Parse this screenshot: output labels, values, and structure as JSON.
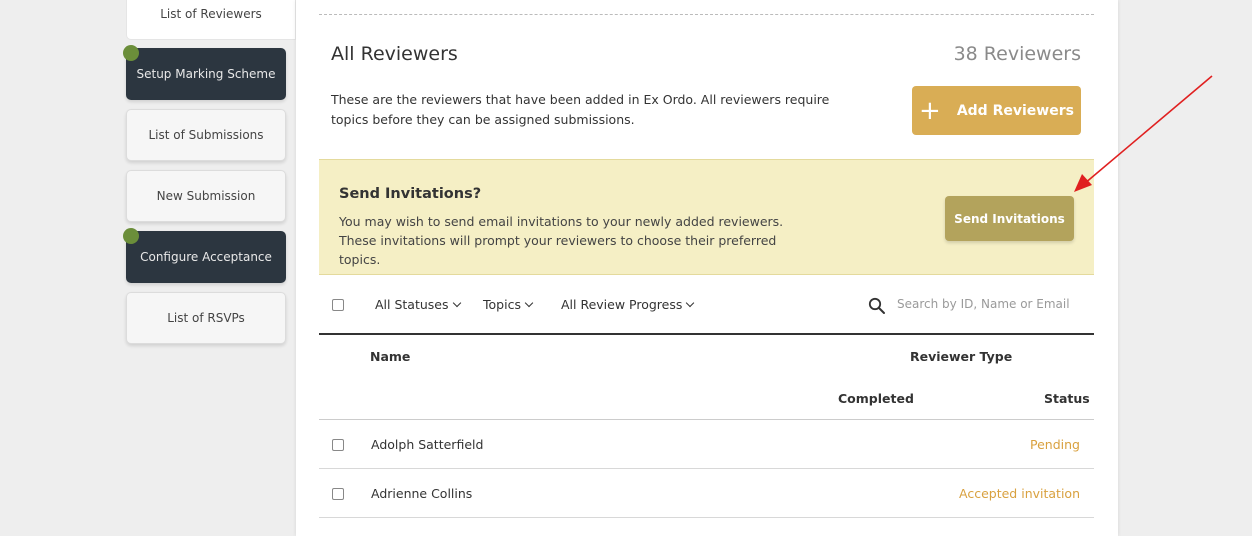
{
  "sidebar": {
    "items": [
      {
        "label": "List of Reviewers",
        "state": "active"
      },
      {
        "label": "Setup Marking Scheme",
        "state": "dark",
        "dot": true
      },
      {
        "label": "List of Submissions",
        "state": "normal"
      },
      {
        "label": "New Submission",
        "state": "normal"
      },
      {
        "label": "Configure Acceptance",
        "state": "dark",
        "dot": true
      },
      {
        "label": "List of RSVPs",
        "state": "normal"
      }
    ]
  },
  "main": {
    "title": "All Reviewers",
    "count": "38 Reviewers",
    "description": "These are the reviewers that have been added in Ex Ordo. All reviewers require topics before they can be assigned submissions.",
    "add_button": "Add Reviewers"
  },
  "invite": {
    "title": "Send Invitations?",
    "text": "You may wish to send email invitations to your newly added reviewers. These invitations will prompt your reviewers to choose their preferred topics.",
    "button": "Send Invitations"
  },
  "filters": {
    "statuses": "All Statuses",
    "topics": "Topics",
    "progress": "All Review Progress",
    "search_placeholder": "Search by ID, Name or Email"
  },
  "table": {
    "headers": {
      "name": "Name",
      "reviewer_type": "Reviewer Type",
      "completed": "Completed",
      "status": "Status"
    },
    "rows": [
      {
        "name": "Adolph Satterfield",
        "status": "Pending"
      },
      {
        "name": "Adrienne Collins",
        "status": "Accepted invitation"
      }
    ]
  },
  "colors": {
    "accent_gold": "#d9ad55",
    "send_button": "#b3a35c",
    "status_text": "#d9a13f",
    "sidebar_dark": "#2c3640",
    "dot_green": "#6b8e3a",
    "annotation_arrow": "#e02020"
  }
}
